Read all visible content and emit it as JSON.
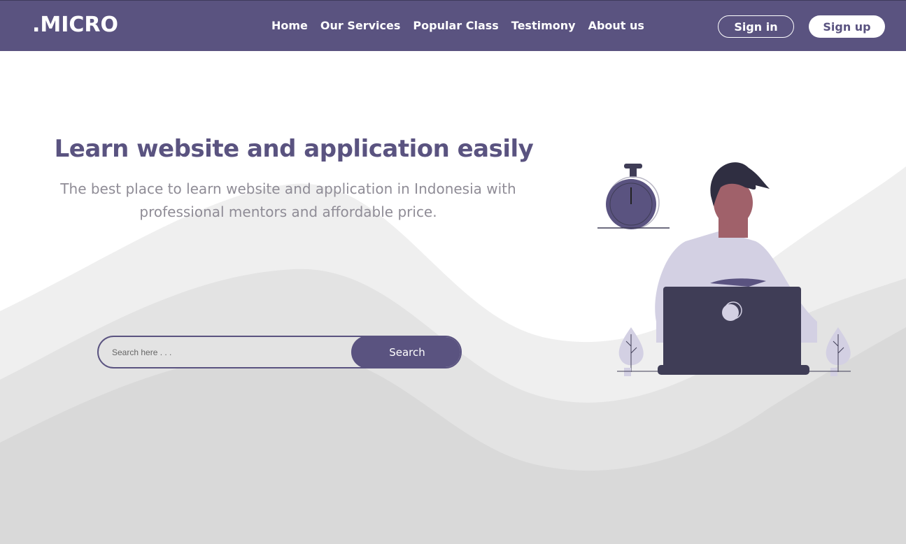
{
  "nav": {
    "logo": ".MICRO",
    "links": [
      "Home",
      "Our Services",
      "Popular Class",
      "Testimony",
      "About us"
    ],
    "signin_label": "Sign in",
    "signup_label": "Sign up"
  },
  "hero": {
    "title": "Learn website and application easily",
    "subtitle": "The best place to learn website and application in Indonesia with professional mentors and affordable price."
  },
  "search": {
    "placeholder": "Search here . . .",
    "button_label": "Search"
  },
  "colors": {
    "brand": "#5a5380",
    "wave_light": "#efefef",
    "wave_mid": "#e3e3e3",
    "wave_dark": "#d9d9d9",
    "laptop": "#3f3d56",
    "shirt": "#d3d0e3",
    "skin": "#a0616a"
  }
}
